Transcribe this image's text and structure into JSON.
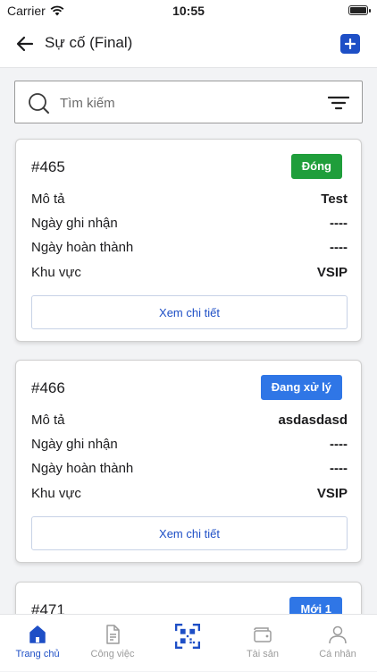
{
  "status_bar": {
    "carrier": "Carrier",
    "time": "10:55"
  },
  "header": {
    "title": "Sự cố (Final)",
    "back_icon": "arrow-left-icon",
    "add_icon": "plus-icon"
  },
  "search": {
    "placeholder": "Tìm kiếm",
    "value": ""
  },
  "cards": [
    {
      "id": "#465",
      "status": "Đóng",
      "status_color": "#1f9e3b",
      "rows": [
        {
          "label": "Mô tả",
          "value": "Test"
        },
        {
          "label": "Ngày ghi nhận",
          "value": "----"
        },
        {
          "label": "Ngày hoàn thành",
          "value": "----"
        },
        {
          "label": "Khu vực",
          "value": "VSIP"
        }
      ],
      "detail_label": "Xem chi tiết"
    },
    {
      "id": "#466",
      "status": "Đang xử lý",
      "status_color": "#2f76e6",
      "rows": [
        {
          "label": "Mô tả",
          "value": "asdasdasd"
        },
        {
          "label": "Ngày ghi nhận",
          "value": "----"
        },
        {
          "label": "Ngày hoàn thành",
          "value": "----"
        },
        {
          "label": "Khu vực",
          "value": "VSIP"
        }
      ],
      "detail_label": "Xem chi tiết"
    },
    {
      "id": "#471",
      "status": "Mới 1",
      "status_color": "#2f76e6"
    }
  ],
  "tabbar": {
    "items": [
      {
        "label": "Trang chủ",
        "icon": "home-icon",
        "active": true
      },
      {
        "label": "Công việc",
        "icon": "document-icon",
        "active": false
      },
      {
        "label": "",
        "icon": "qr-code-icon",
        "active": false
      },
      {
        "label": "Tài sản",
        "icon": "wallet-icon",
        "active": false
      },
      {
        "label": "Cá nhân",
        "icon": "user-icon",
        "active": false
      }
    ]
  },
  "colors": {
    "accent": "#1e4fc6",
    "closed": "#1f9e3b",
    "processing": "#2f76e6"
  }
}
